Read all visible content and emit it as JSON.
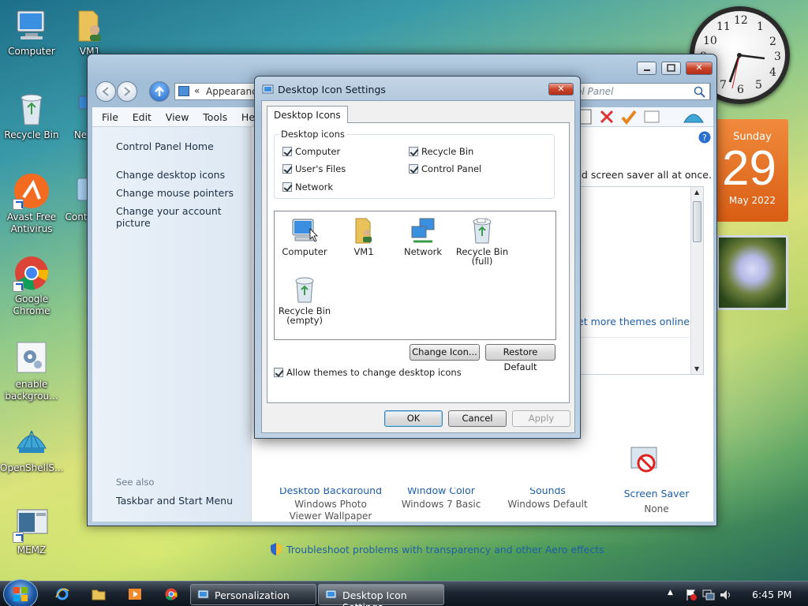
{
  "desktop": {
    "icons": [
      {
        "label": "Computer"
      },
      {
        "label": "VM1"
      },
      {
        "label": "Recycle Bin"
      },
      {
        "label": "Ne"
      },
      {
        "label": "Avast Free Antivirus"
      },
      {
        "label": "Contr"
      },
      {
        "label": "Google Chrome"
      },
      {
        "label": "enable backgrou..."
      },
      {
        "label": "OpenShellS..."
      },
      {
        "label": "MEMZ"
      }
    ]
  },
  "clock": {
    "numbers": [
      "12",
      "1",
      "2",
      "3",
      "4",
      "5",
      "6",
      "7",
      "8",
      "9",
      "10",
      "11"
    ]
  },
  "calendar": {
    "weekday": "Sunday",
    "day": "29",
    "month_year": "May 2022"
  },
  "main_window": {
    "address_parts": [
      "«",
      "Appearance"
    ],
    "search_tail": "ol Panel",
    "menu": [
      "File",
      "Edit",
      "View",
      "Tools",
      "Help"
    ],
    "left_links": [
      "Control Panel Home",
      "Change desktop icons",
      "Change mouse pointers",
      "Change your account picture"
    ],
    "see_also_label": "See also",
    "see_also_links": [
      "Taskbar and Start Menu"
    ],
    "content_text_1": "nd screen saver all at once.",
    "content_link_1": "et more themes online",
    "bottom_items": [
      {
        "title": "Desktop Background",
        "value": "Windows Photo Viewer Wallpaper"
      },
      {
        "title": "Window Color",
        "value": "Windows 7 Basic"
      },
      {
        "title": "Sounds",
        "value": "Windows Default"
      },
      {
        "title": "Screen Saver",
        "value": "None"
      }
    ],
    "troubleshoot_link": "Troubleshoot problems with transparency and other Aero effects"
  },
  "dialog": {
    "title": "Desktop Icon Settings",
    "tab": "Desktop Icons",
    "group_title": "Desktop icons",
    "checkboxes": [
      {
        "label": "Computer",
        "checked": true
      },
      {
        "label": "Recycle Bin",
        "checked": true
      },
      {
        "label": "User's Files",
        "checked": true
      },
      {
        "label": "Control Panel",
        "checked": true
      },
      {
        "label": "Network",
        "checked": true
      }
    ],
    "icons": [
      {
        "label": "Computer"
      },
      {
        "label": "VM1"
      },
      {
        "label": "Network"
      },
      {
        "label": "Recycle Bin (full)"
      },
      {
        "label": "Recycle Bin (empty)"
      }
    ],
    "change_icon_label": "Change Icon...",
    "restore_default_label": "Restore Default",
    "allow_themes_label": "Allow themes to change desktop icons",
    "ok_label": "OK",
    "cancel_label": "Cancel",
    "apply_label": "Apply"
  },
  "taskbar": {
    "buttons": [
      {
        "label": "Personalization"
      },
      {
        "label": "Desktop Icon Settings"
      }
    ],
    "time": "6:45 PM"
  },
  "colors": {
    "link": "#1d5fa6",
    "accent_orange": "#e3691e"
  }
}
